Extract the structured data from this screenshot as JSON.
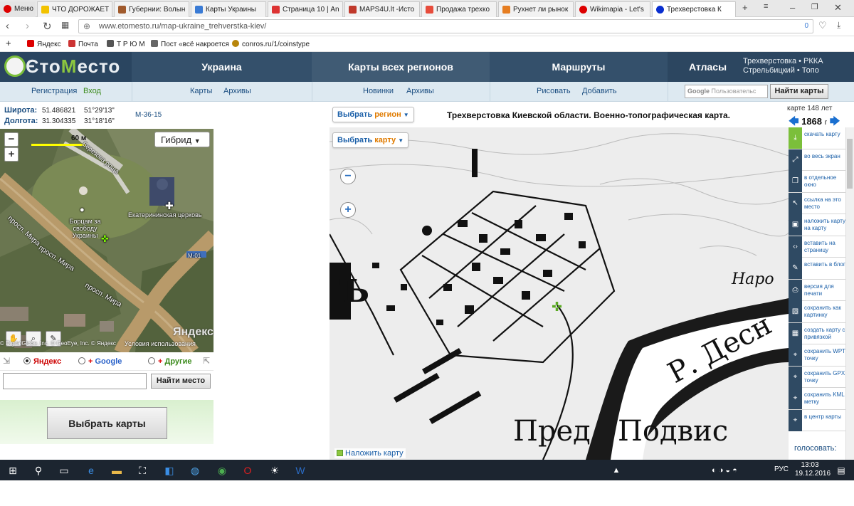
{
  "browser": {
    "menu_label": "Меню",
    "tabs": [
      {
        "title": "ЧТО ДОРОЖАЕТ",
        "color": "#f2c200"
      },
      {
        "title": "Губернии: Волын",
        "color": "#a05a2c"
      },
      {
        "title": "Карты Украины",
        "color": "#3a7bd5"
      },
      {
        "title": "Страница 10 | An",
        "color": "#d33"
      },
      {
        "title": "MAPS4U.lt -Исто",
        "color": "#c0392b"
      },
      {
        "title": "Продажа трехко",
        "color": "#e74c3c"
      },
      {
        "title": "Рухнет ли рынок",
        "color": "#e67e22"
      },
      {
        "title": "Wikimapia - Let's",
        "color": "#d00"
      },
      {
        "title": "Трехверстовка К",
        "color": "#0a2fd0"
      }
    ],
    "url": "www.etomesto.ru/map-ukraine_trehverstka-kiev/",
    "url_badge": "0",
    "bookmarks": [
      "Яндекс",
      "Почта",
      "Т Р Ю М",
      "Пост «всё накроется",
      "conros.ru/1/coinstype"
    ]
  },
  "site": {
    "logo_prefix": "Єто",
    "logo_accent": "М",
    "logo_suffix": "есто",
    "nav": {
      "ukraine": "Украина",
      "regions": "Карты всех регионов",
      "routes": "Маршруты",
      "atlases": "Атласы",
      "atlas_sub1": "Трехверстовка • РККА",
      "atlas_sub2": "Стрельбицкий • Топо"
    },
    "sub": {
      "register": "Регистрация",
      "login": "Вход",
      "maps": "Карты",
      "archives1": "Архивы",
      "news": "Новинки",
      "archives2": "Архивы",
      "draw": "Рисовать",
      "add": "Добавить",
      "search_brand": "Google",
      "search_placeholder": "Пользовательс",
      "find_maps": "Найти карты"
    }
  },
  "left": {
    "lat_label": "Широта:",
    "lat_dec": "51.486821",
    "lat_dms": "51°29'13\"",
    "lon_label": "Долгота:",
    "lon_dec": "31.304335",
    "lon_dms": "31°18'16\"",
    "sheet": "M-36-15",
    "hybrid": "Гибрид",
    "scale": "60 м",
    "labels": {
      "monument": "Борцам за свободу Украины",
      "church": "Екатерининская церковь",
      "street1": "просп. Мира",
      "street2": "просп. Мира",
      "street3": "просп. Мира",
      "street4": "Березова роща",
      "road": "М-01"
    },
    "yandex_wm": "Яндекс",
    "copyright": "© DigitalGlobe, Inc. © GeoEye, Inc. © Яндекс",
    "terms": "Условия использования",
    "providers": {
      "yandex": "Яндекс",
      "google_plus": "+",
      "google": "Google",
      "other_plus": "+",
      "other": "Другие"
    },
    "find_place": "Найти место",
    "choose_maps": "Выбрать карты"
  },
  "map": {
    "choose_region_a": "Выбрать ",
    "choose_region_b": "регион",
    "choose_map_a": "Выбрать ",
    "choose_map_b": "карту",
    "title": "Трехверстовка Киевской области. Военно-топографическая карта.",
    "age": "карте 148 лет",
    "year": "1868",
    "year_suffix": "г",
    "overlay": "Наложить карту",
    "old_labels": {
      "desna": "Р. Десн",
      "pred": "Пред",
      "podvis": "Подвис",
      "naro": "Наро",
      "b": "Ъ"
    }
  },
  "actions": [
    {
      "label": "скачать карту",
      "icon": "download-icon"
    },
    {
      "label": "во весь экран",
      "icon": "fullscreen-icon"
    },
    {
      "label": "в отдельное окно",
      "icon": "window-icon"
    },
    {
      "label": "ссылка на это место",
      "icon": "pointer-icon"
    },
    {
      "label": "наложить карту на карту",
      "icon": "layers-icon"
    },
    {
      "label": "вставить на страницу",
      "icon": "code-icon"
    },
    {
      "label": "вставить в блог",
      "icon": "pen-icon"
    },
    {
      "label": "версия для печати",
      "icon": "print-icon"
    },
    {
      "label": "сохранить как картинку",
      "icon": "image-icon"
    },
    {
      "label": "создать карту с привязкой",
      "icon": "grid-icon"
    },
    {
      "label": "сохранить WPT точку",
      "icon": "pin-icon"
    },
    {
      "label": "сохранить GPX точку",
      "icon": "pin-icon"
    },
    {
      "label": "сохранить KML метку",
      "icon": "pin-icon"
    },
    {
      "label": "в центр карты",
      "icon": "pin-icon"
    }
  ],
  "vote": "голосовать:",
  "taskbar": {
    "lang": "РУС",
    "time": "13:03",
    "date": "19.12.2016"
  }
}
